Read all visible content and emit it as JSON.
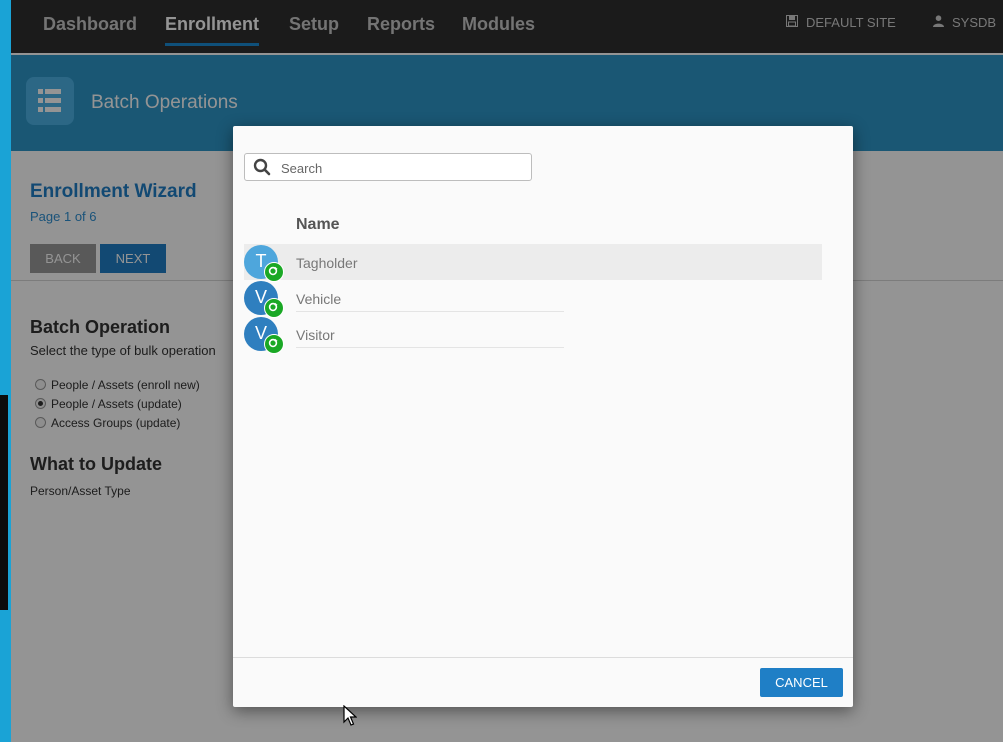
{
  "nav": {
    "items": [
      "Dashboard",
      "Enrollment",
      "Setup",
      "Reports",
      "Modules"
    ],
    "active": "Enrollment",
    "site_label": "DEFAULT SITE",
    "user_label": "SYSDB"
  },
  "header": {
    "title": "Batch Operations",
    "icon": "list-icon"
  },
  "wizard": {
    "title": "Enrollment Wizard",
    "page_indicator": "Page 1 of 6",
    "back_label": "BACK",
    "next_label": "NEXT"
  },
  "batch": {
    "title": "Batch Operation",
    "description": "Select the type of bulk operation",
    "options": [
      {
        "label": "People / Assets (enroll new)",
        "checked": false
      },
      {
        "label": "People / Assets (update)",
        "checked": true
      },
      {
        "label": "Access Groups (update)",
        "checked": false
      }
    ]
  },
  "update": {
    "title": "What to Update",
    "field_label": "Person/Asset Type"
  },
  "modal": {
    "search_placeholder": "Search",
    "column_header": "Name",
    "items": [
      {
        "initial": "T",
        "label": "Tagholder",
        "color": "#4ea6dc",
        "selected": true
      },
      {
        "initial": "V",
        "label": "Vehicle",
        "color": "#2f7fbf",
        "selected": false
      },
      {
        "initial": "V",
        "label": "Visitor",
        "color": "#2f7fbf",
        "selected": false
      }
    ],
    "cancel_label": "CANCEL"
  },
  "colors": {
    "accent": "#1f7fc6",
    "header_band": "#2e97c9",
    "badge_green": "#1aa825"
  }
}
